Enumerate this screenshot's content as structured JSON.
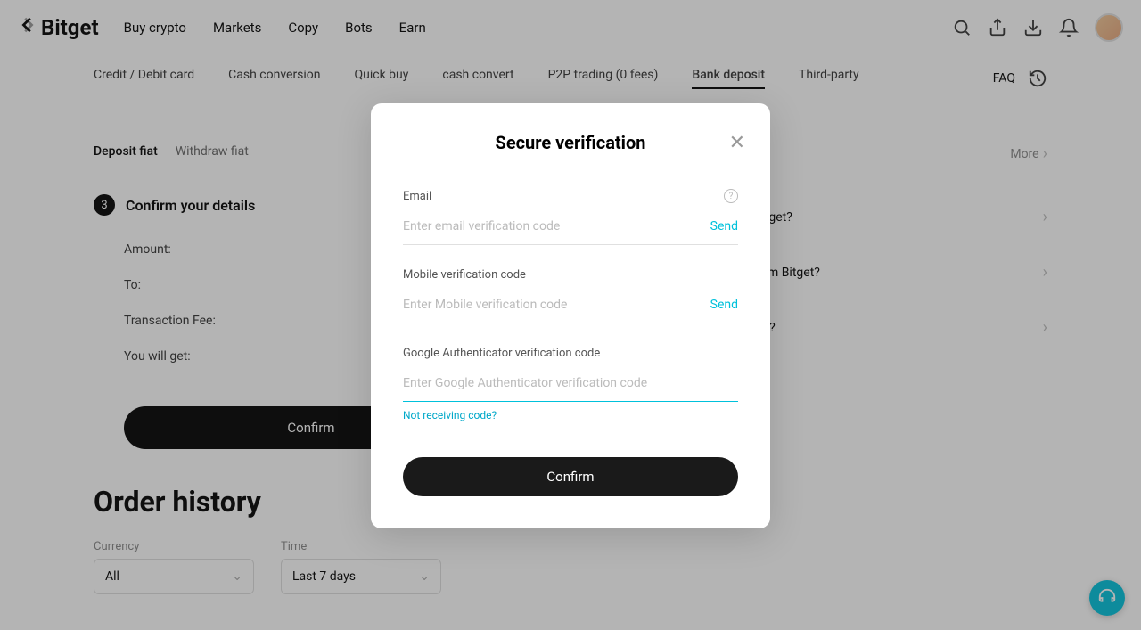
{
  "header": {
    "logo": "Bitget",
    "nav": {
      "buy": "Buy crypto",
      "markets": "Markets",
      "copy": "Copy",
      "bots": "Bots",
      "earn": "Earn"
    }
  },
  "subnav": {
    "credit": "Credit / Debit card",
    "cash": "Cash conversion",
    "quick": "Quick buy",
    "convert": "cash convert",
    "p2p": "P2P trading (0 fees)",
    "bank": "Bank deposit",
    "third": "Third-party",
    "faq": "FAQ"
  },
  "fiat_tabs": {
    "deposit": "Deposit fiat",
    "withdraw": "Withdraw fiat"
  },
  "step": {
    "num": "3",
    "title": "Confirm your details",
    "amount_label": "Amount:",
    "to_label": "To:",
    "fee_label": "Transaction Fee:",
    "get_label": "You will get:",
    "confirm": "Confirm"
  },
  "sidebar": {
    "more": "More",
    "faq1": "…R on Bitget?",
    "faq2": "…EUR from Bitget?",
    "faq3": "…ls arrive?"
  },
  "order_history": {
    "title": "Order history",
    "currency_label": "Currency",
    "currency_value": "All",
    "time_label": "Time",
    "time_value": "Last 7 days"
  },
  "modal": {
    "title": "Secure verification",
    "email_label": "Email",
    "email_placeholder": "Enter email verification code",
    "send": "Send",
    "mobile_label": "Mobile verification code",
    "mobile_placeholder": "Enter Mobile verification code",
    "ga_label": "Google Authenticator verification code",
    "ga_placeholder": "Enter Google Authenticator verification code",
    "not_receiving": "Not receiving code?",
    "confirm": "Confirm"
  }
}
